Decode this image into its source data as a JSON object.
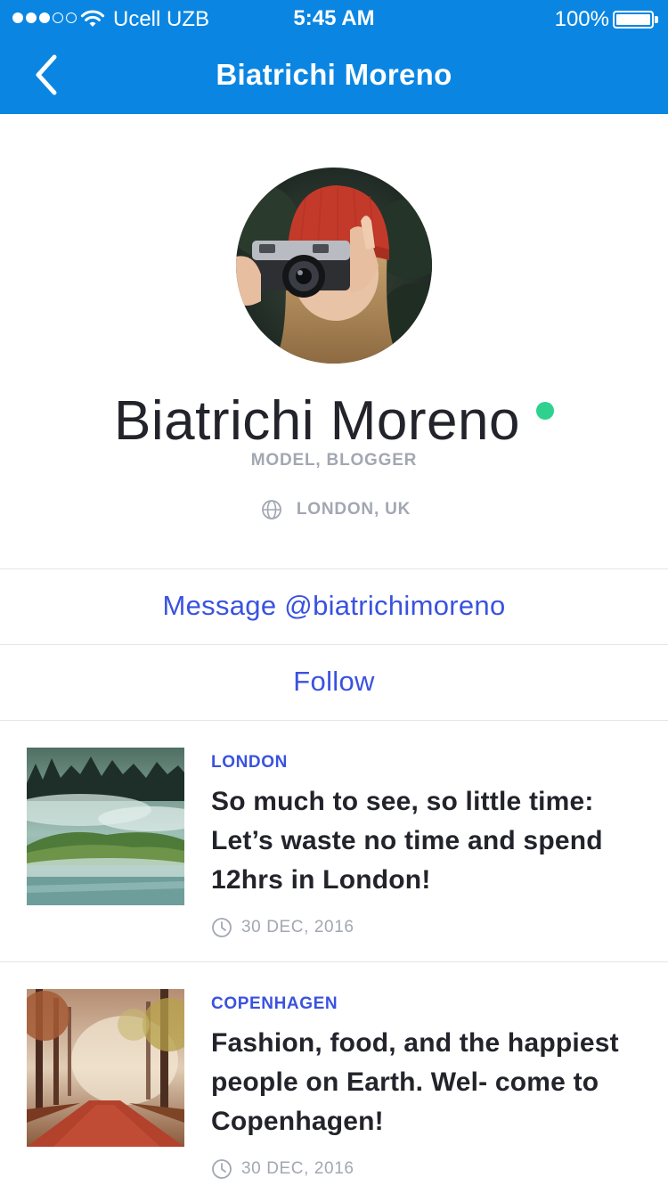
{
  "status_bar": {
    "carrier": "Ucell UZB",
    "time": "5:45 AM",
    "battery": "100%",
    "signal_bars_filled": 3,
    "signal_bars_total": 5
  },
  "nav": {
    "title": "Biatrichi Moreno",
    "back_icon": "chevron-left-icon"
  },
  "profile": {
    "name": "Biatrichi Moreno",
    "role": "MODEL, BLOGGER",
    "location": "LONDON, UK",
    "online": true
  },
  "actions": {
    "message_label": "Message @biatrichimoreno",
    "follow_label": "Follow"
  },
  "posts": [
    {
      "tag": "LONDON",
      "title": "So much to see, so little time: Let’s waste no time and spend 12hrs in London!",
      "date": "30 DEC, 2016"
    },
    {
      "tag": "COPENHAGEN",
      "title": "Fashion, food, and the happiest people on Earth. Wel- come to Copenhagen!",
      "date": "30 DEC, 2016"
    }
  ],
  "colors": {
    "header_bg": "#0a86e2",
    "accent": "#3a52e0",
    "online": "#2fd18f",
    "muted": "#a2a7b2",
    "text": "#23242b",
    "divider": "#e3e5ea"
  }
}
